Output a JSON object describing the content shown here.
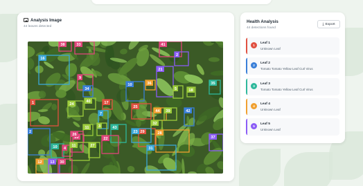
{
  "analysis": {
    "title": "Analysis Image",
    "subtitle": "44 leaves detected",
    "boxes": [
      {
        "label": "38",
        "color": "#e0457b"
      },
      {
        "label": "33",
        "color": "#e0457b"
      },
      {
        "label": "41",
        "color": "#e0457b"
      },
      {
        "label": "2",
        "color": "#8b5cf6"
      },
      {
        "label": "16",
        "color": "#3aa7d8"
      },
      {
        "label": "9",
        "color": "#e0457b"
      },
      {
        "label": "21",
        "color": "#8b5cf6"
      },
      {
        "label": "10",
        "color": "#3a7fd8"
      },
      {
        "label": "36",
        "color": "#f0a030"
      },
      {
        "label": "5",
        "color": "#9ccc3c"
      },
      {
        "label": "18",
        "color": "#9ccc3c"
      },
      {
        "label": "35",
        "color": "#2fb89c"
      },
      {
        "label": "34",
        "color": "#3a7fd8"
      },
      {
        "label": "40",
        "color": "#9ccc3c"
      },
      {
        "label": "24",
        "color": "#9ccc3c"
      },
      {
        "label": "17",
        "color": "#e05040"
      },
      {
        "label": "1",
        "color": "#e05040"
      },
      {
        "label": "44",
        "color": "#f0a030"
      },
      {
        "label": "39",
        "color": "#9ccc3c"
      },
      {
        "label": "42",
        "color": "#3a7fd8"
      },
      {
        "label": "25",
        "color": "#e05040"
      },
      {
        "label": "32",
        "color": "#9ccc3c"
      },
      {
        "label": "7",
        "color": "#3aa7d8"
      },
      {
        "label": "20",
        "color": "#e0457b"
      },
      {
        "label": "11",
        "color": "#9ccc3c"
      },
      {
        "label": "3",
        "color": "#9ccc3c"
      },
      {
        "label": "43",
        "color": "#2fb89c"
      },
      {
        "label": "29",
        "color": "#e05040"
      },
      {
        "label": "28",
        "color": "#f0a030"
      },
      {
        "label": "2",
        "color": "#3a7fd8"
      },
      {
        "label": "26",
        "color": "#e0457b"
      },
      {
        "label": "27",
        "color": "#9ccc3c"
      },
      {
        "label": "22",
        "color": "#e0457b"
      },
      {
        "label": "23",
        "color": "#3aa7d8"
      },
      {
        "label": "37",
        "color": "#8b5cf6"
      },
      {
        "label": "10",
        "color": "#2fb89c"
      },
      {
        "label": "4",
        "color": "#e0457b"
      },
      {
        "label": "11",
        "color": "#9ccc3c"
      },
      {
        "label": "31",
        "color": "#3aa7d8"
      },
      {
        "label": "12",
        "color": "#f0a030"
      },
      {
        "label": "13",
        "color": "#8b5cf6"
      },
      {
        "label": "30",
        "color": "#e0457b"
      }
    ]
  },
  "health": {
    "title": "Health Analysis",
    "subtitle": "44 detections found",
    "export_label": "Export",
    "export_icon": "download-icon",
    "detections": [
      {
        "num": "1",
        "name": "Leaf 1",
        "desc": "Unknown Leaf",
        "color": "#e05040"
      },
      {
        "num": "2",
        "name": "Leaf 2",
        "desc": "Tomato Tomato Yellow Leaf Curl Virus",
        "color": "#3a7fd8"
      },
      {
        "num": "3",
        "name": "Leaf 3",
        "desc": "Tomato Tomato Yellow Leaf Curl Virus",
        "color": "#2fb89c"
      },
      {
        "num": "4",
        "name": "Leaf 4",
        "desc": "Unknown Leaf",
        "color": "#f0a030"
      },
      {
        "num": "5",
        "name": "Leaf 5",
        "desc": "Unknown Leaf",
        "color": "#8b5cf6"
      }
    ]
  }
}
